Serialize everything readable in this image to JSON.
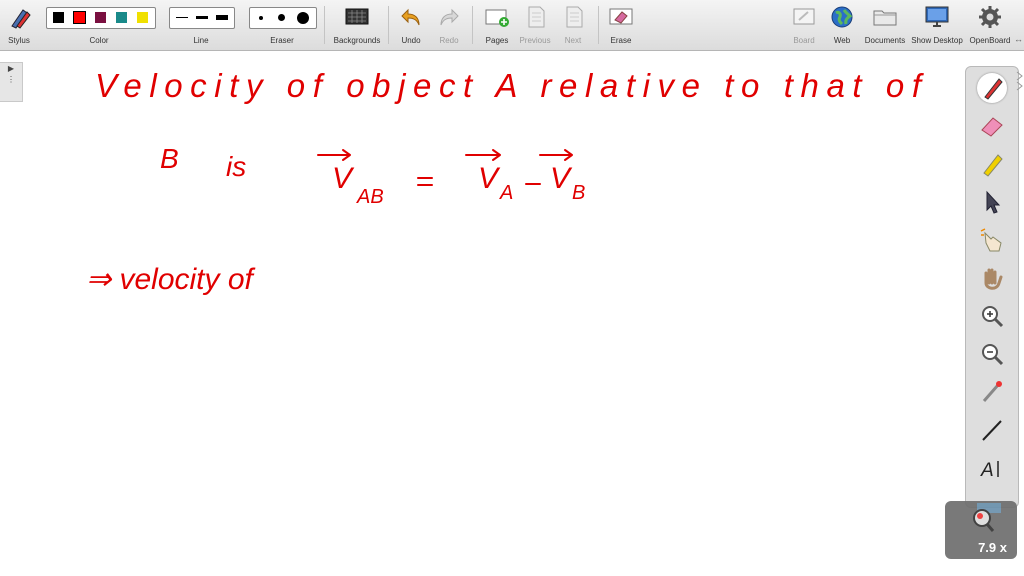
{
  "toolbar": {
    "stylus": "Stylus",
    "color": "Color",
    "line": "Line",
    "eraser": "Eraser",
    "backgrounds": "Backgrounds",
    "undo": "Undo",
    "redo": "Redo",
    "pages": "Pages",
    "previous": "Previous",
    "next": "Next",
    "erase": "Erase",
    "board": "Board",
    "web": "Web",
    "documents": "Documents",
    "show_desktop": "Show Desktop",
    "openboard": "OpenBoard",
    "colors": [
      "#000000",
      "#ff0000",
      "#7a1040",
      "#1a8a8a",
      "#f0e000"
    ]
  },
  "canvas": {
    "line1": "Velocity of object A relative to that of",
    "line2_b": "B",
    "line2_is": "is",
    "line3": "⇒ velocity of",
    "ink_color": "#e00000"
  },
  "zoom": {
    "value": "7.9 x"
  }
}
